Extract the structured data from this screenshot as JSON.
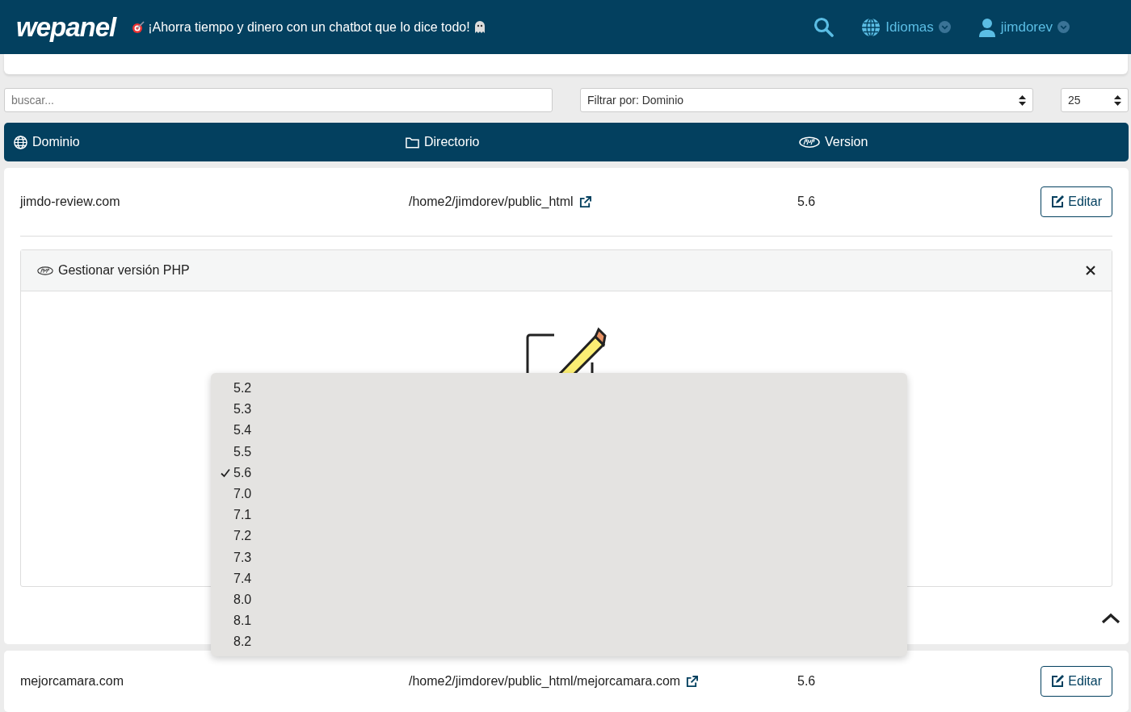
{
  "header": {
    "logo": "wepanel",
    "announcement": "¡Ahorra tiempo y dinero con un chatbot que lo dice todo!",
    "menus": [
      {
        "kind": "language",
        "label": "Idiomas"
      },
      {
        "kind": "user",
        "label": "jimdorev"
      }
    ]
  },
  "filters": {
    "search": {
      "placeholder": "buscar..."
    },
    "filter": {
      "value": "Filtrar por: Dominio"
    },
    "page_size": {
      "value": "25"
    }
  },
  "table": {
    "columns": [
      {
        "kind": "globe",
        "label": "Dominio"
      },
      {
        "kind": "folder",
        "label": "Directorio"
      },
      {
        "kind": "php",
        "label": "Version"
      }
    ],
    "rows": [
      {
        "domain": "jimdo-review.com",
        "directory": "/home2/jimdorev/public_html",
        "version": "5.6",
        "button": "Editar",
        "expanded": true
      },
      {
        "domain": "mejorcamara.com",
        "directory": "/home2/jimdorev/public_html/mejorcamara.com",
        "version": "5.6",
        "button": "Editar",
        "expanded": false
      }
    ]
  },
  "panel": {
    "title": "Gestionar versión PHP"
  },
  "dropdown": {
    "options": [
      {
        "label": "5.2",
        "selected": false
      },
      {
        "label": "5.3",
        "selected": false
      },
      {
        "label": "5.4",
        "selected": false
      },
      {
        "label": "5.5",
        "selected": false
      },
      {
        "label": "5.6",
        "selected": true
      },
      {
        "label": "7.0",
        "selected": false
      },
      {
        "label": "7.1",
        "selected": false
      },
      {
        "label": "7.2",
        "selected": false
      },
      {
        "label": "7.3",
        "selected": false
      },
      {
        "label": "7.4",
        "selected": false
      },
      {
        "label": "8.0",
        "selected": false
      },
      {
        "label": "8.1",
        "selected": false
      },
      {
        "label": "8.2",
        "selected": false
      }
    ]
  }
}
